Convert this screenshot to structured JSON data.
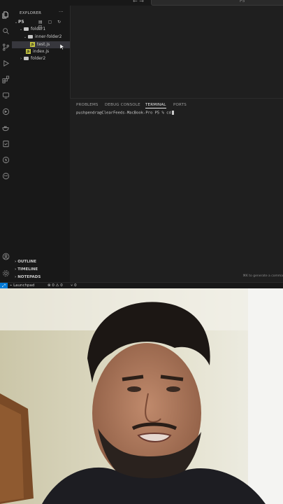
{
  "titlebar": {
    "search_text": "P5"
  },
  "sidebar": {
    "title": "EXPLORER",
    "more": "···",
    "tree": [
      {
        "label": "P5",
        "level": 0,
        "kind": "root"
      },
      {
        "label": "folder1",
        "level": 1,
        "kind": "folder-open"
      },
      {
        "label": "inner-folder2",
        "level": 2,
        "kind": "folder-open"
      },
      {
        "label": "test.js",
        "level": 3,
        "kind": "file",
        "selected": true
      },
      {
        "label": "index.js",
        "level": 2,
        "kind": "file"
      },
      {
        "label": "folder2",
        "level": 1,
        "kind": "folder-closed"
      }
    ],
    "sections": [
      "OUTLINE",
      "TIMELINE",
      "NOTEPADS"
    ]
  },
  "panel": {
    "tabs": [
      "PROBLEMS",
      "DEBUG CONSOLE",
      "TERMINAL",
      "PORTS"
    ],
    "active_tab": "TERMINAL",
    "terminal_line": "pushpendra@ClearFeeds-MacBook-Pro P5 % cd",
    "hint": "⌘K to generate a comma"
  },
  "statusbar": {
    "launchpad": "Launchpad",
    "errors": "0",
    "warnings": "0",
    "ports": "0"
  },
  "icons": {
    "activity": [
      "files-icon",
      "search-icon",
      "source-control-icon",
      "run-debug-icon",
      "extensions-icon",
      "remote-explorer-icon",
      "gitlens-icon",
      "docker-icon",
      "testing-icon",
      "lightning-icon",
      "copilot-icon"
    ],
    "bottom_activity": [
      "account-icon",
      "settings-icon"
    ]
  },
  "colors": {
    "accent": "#0078d4",
    "js_icon": "#cbcb41",
    "editor_bg": "#1f1f1f",
    "sidebar_bg": "#181818"
  }
}
